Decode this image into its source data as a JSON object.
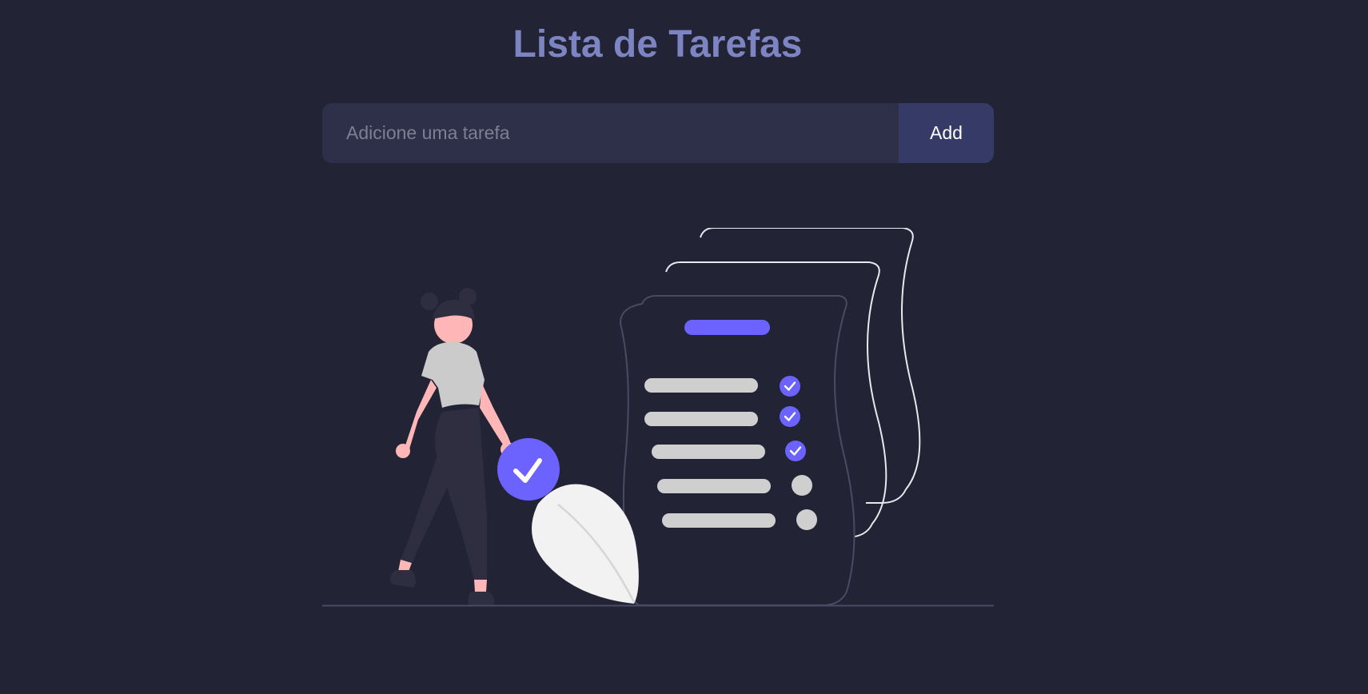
{
  "header": {
    "title": "Lista de Tarefas"
  },
  "task_form": {
    "input_placeholder": "Adicione uma tarefa",
    "input_value": "",
    "add_label": "Add"
  },
  "empty_state": {
    "illustration": "woman-checklist-illustration",
    "checklist_items_total": 5,
    "checklist_items_checked": 3
  },
  "colors": {
    "background": "#222335",
    "title": "#7c84c2",
    "input_bg": "#2e2f48",
    "button_bg": "#353a66",
    "accent": "#6c63ff"
  }
}
